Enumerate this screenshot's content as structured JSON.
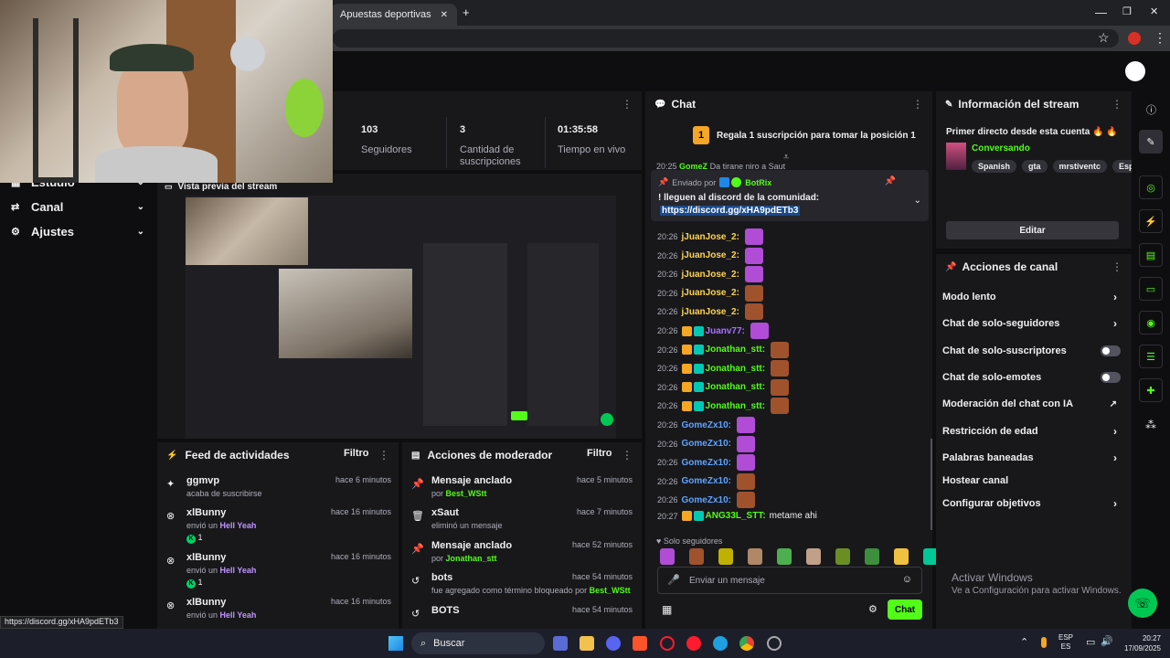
{
  "browser": {
    "tab_title": "Apuestas deportivas Wplay.co",
    "new_tab": "+",
    "win_min": "—",
    "win_max": "❐",
    "win_close": "✕",
    "star": "☆",
    "menu": "⋮"
  },
  "nav": {
    "items": [
      {
        "label": "Estudio"
      },
      {
        "label": "Canal"
      },
      {
        "label": "Ajustes"
      }
    ]
  },
  "stats": [
    {
      "value": "103",
      "label": "Seguidores"
    },
    {
      "value": "3",
      "label": "Cantidad de suscripciones"
    },
    {
      "value": "01:35:58",
      "label": "Tiempo en vivo"
    }
  ],
  "preview": {
    "title": "Vista previa del stream"
  },
  "activity": {
    "title": "Feed de actividades",
    "filter": "Filtro",
    "items": [
      {
        "name": "ggmvp",
        "time": "hace 6 minutos",
        "desc": "acaba de suscribirse",
        "extra": ""
      },
      {
        "name": "xlBunny",
        "time": "hace 16 minutos",
        "desc": "envió un",
        "item": "Hell Yeah",
        "extra": "1"
      },
      {
        "name": "xlBunny",
        "time": "hace 16 minutos",
        "desc": "envió un",
        "item": "Hell Yeah",
        "extra": "1"
      },
      {
        "name": "xlBunny",
        "time": "hace 16 minutos",
        "desc": "envió un",
        "item": "Hell Yeah",
        "extra": ""
      }
    ]
  },
  "modactions": {
    "title": "Acciones de moderador",
    "filter": "Filtro",
    "items": [
      {
        "name": "Mensaje anclado",
        "time": "hace 5 minutos",
        "pre": "por",
        "who": "Best_WStt",
        "post": ""
      },
      {
        "name": "xSaut",
        "time": "hace 7 minutos",
        "pre": "eliminó un mensaje",
        "who": "",
        "post": ""
      },
      {
        "name": "Mensaje anclado",
        "time": "hace 52 minutos",
        "pre": "por",
        "who": "Jonathan_stt",
        "post": ""
      },
      {
        "name": "bots",
        "time": "hace 54 minutos",
        "pre": "fue agregado como término bloqueado por",
        "who": "Best_WStt",
        "post": ""
      },
      {
        "name": "BOTS",
        "time": "hace 54 minutos",
        "pre": "",
        "who": "",
        "post": ""
      }
    ]
  },
  "chat": {
    "title": "Chat",
    "gift_rank": "1",
    "gift_text": "Regala 1 suscripción para tomar la posición 1",
    "pinned_sender_label": "Enviado por",
    "pinned_sender": "BotRix",
    "pinned_msg": "! lleguen al discord de la comunidad:",
    "pinned_link": "https://discord.gg/xHA9pdETb3",
    "partial_time": "20:25",
    "partial_user": "GomeZ",
    "partial_msg": "Da tirane niro a Saut",
    "lines": [
      {
        "time": "20:26",
        "user": "jJuanJose_2:",
        "color": "#ffd54f",
        "badges": 0,
        "msg": ""
      },
      {
        "time": "20:26",
        "user": "jJuanJose_2:",
        "color": "#ffd54f",
        "badges": 0,
        "msg": ""
      },
      {
        "time": "20:26",
        "user": "jJuanJose_2:",
        "color": "#ffd54f",
        "badges": 0,
        "msg": ""
      },
      {
        "time": "20:26",
        "user": "jJuanJose_2:",
        "color": "#ffd54f",
        "badges": 0,
        "msg": ""
      },
      {
        "time": "20:26",
        "user": "jJuanJose_2:",
        "color": "#ffd54f",
        "badges": 0,
        "msg": ""
      },
      {
        "time": "20:26",
        "user": "Juanv77:",
        "color": "#a970ff",
        "badges": 2,
        "msg": ""
      },
      {
        "time": "20:26",
        "user": "Jonathan_stt:",
        "color": "#53fc18",
        "badges": 2,
        "msg": ""
      },
      {
        "time": "20:26",
        "user": "Jonathan_stt:",
        "color": "#53fc18",
        "badges": 2,
        "msg": ""
      },
      {
        "time": "20:26",
        "user": "Jonathan_stt:",
        "color": "#53fc18",
        "badges": 2,
        "msg": ""
      },
      {
        "time": "20:26",
        "user": "Jonathan_stt:",
        "color": "#53fc18",
        "badges": 2,
        "msg": ""
      },
      {
        "time": "20:26",
        "user": "GomeZx10:",
        "color": "#5ea3ff",
        "badges": 0,
        "msg": ""
      },
      {
        "time": "20:26",
        "user": "GomeZx10:",
        "color": "#5ea3ff",
        "badges": 0,
        "msg": ""
      },
      {
        "time": "20:26",
        "user": "GomeZx10:",
        "color": "#5ea3ff",
        "badges": 0,
        "msg": ""
      },
      {
        "time": "20:26",
        "user": "GomeZx10:",
        "color": "#5ea3ff",
        "badges": 0,
        "msg": ""
      },
      {
        "time": "20:26",
        "user": "GomeZx10:",
        "color": "#5ea3ff",
        "badges": 0,
        "msg": ""
      },
      {
        "time": "20:27",
        "user": "ANG33L_STT:",
        "color": "#53fc18",
        "badges": 2,
        "msg": "metame ahi"
      }
    ],
    "mode_label": "Solo seguidores",
    "input_placeholder": "Enviar un mensaje",
    "send": "Chat"
  },
  "streaminfo": {
    "title": "Información del stream",
    "stream_title": "Primer directo desde esta cuenta 🔥 🔥",
    "category": "Conversando",
    "tags": [
      "Spanish",
      "gta",
      "mrstiventc",
      "Españ"
    ],
    "edit": "Editar"
  },
  "channelactions": {
    "title": "Acciones de canal",
    "items": [
      {
        "label": "Modo lento",
        "kind": "arrow"
      },
      {
        "label": "Chat de solo-seguidores",
        "kind": "arrow"
      },
      {
        "label": "Chat de solo-suscriptores",
        "kind": "toggle"
      },
      {
        "label": "Chat de solo-emotes",
        "kind": "toggle"
      },
      {
        "label": "Moderación del chat con IA",
        "kind": "external"
      },
      {
        "label": "Restricción de edad",
        "kind": "arrow"
      },
      {
        "label": "Palabras baneadas",
        "kind": "arrow"
      },
      {
        "label": "Hostear canal",
        "kind": "none"
      },
      {
        "label": "Configurar objetivos",
        "kind": "arrow"
      }
    ]
  },
  "watermark": {
    "line1": "Activar Windows",
    "line2": "Ve a Configuración para activar Windows."
  },
  "statusbar": {
    "url": "https://discord.gg/xHA9pdETb3"
  },
  "taskbar": {
    "search": "Buscar",
    "lang1": "ESP",
    "lang2": "ES",
    "time": "20:27",
    "date": "17/09/2025"
  },
  "colors": {
    "accent": "#53fc18",
    "panel": "#18181b",
    "bg": "#0e0e10"
  }
}
